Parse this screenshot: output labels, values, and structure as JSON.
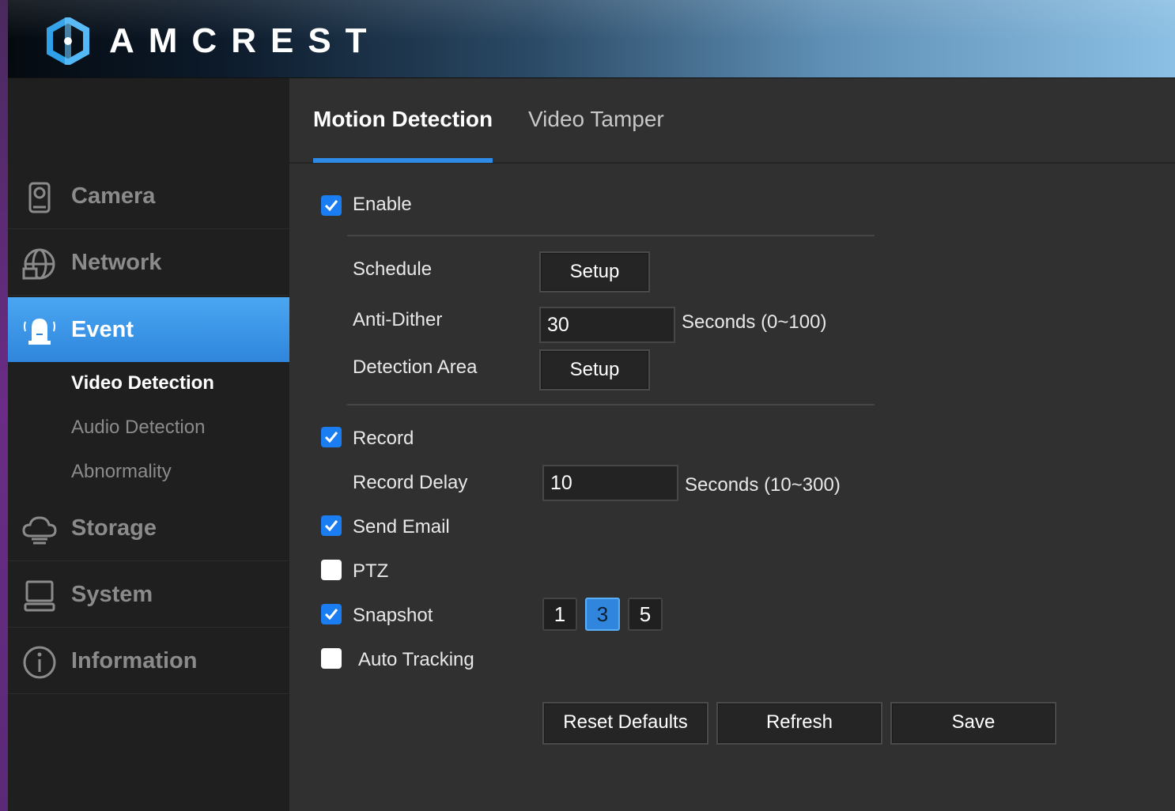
{
  "brand": {
    "name": "AMCREST"
  },
  "sidebar": {
    "items": [
      {
        "label": "Camera",
        "icon": "camera-icon"
      },
      {
        "label": "Network",
        "icon": "globe-network-icon"
      },
      {
        "label": "Event",
        "icon": "alarm-bell-icon",
        "active": true
      },
      {
        "label": "Storage",
        "icon": "cloud-storage-icon"
      },
      {
        "label": "System",
        "icon": "computer-icon"
      },
      {
        "label": "Information",
        "icon": "info-icon"
      }
    ],
    "sub_items": [
      {
        "label": "Video Detection",
        "active": true
      },
      {
        "label": "Audio Detection"
      },
      {
        "label": "Abnormality"
      }
    ]
  },
  "tabs": [
    {
      "label": "Motion Detection",
      "active": true
    },
    {
      "label": "Video Tamper"
    }
  ],
  "form": {
    "enable": {
      "label": "Enable",
      "checked": true
    },
    "schedule": {
      "label": "Schedule",
      "button": "Setup"
    },
    "anti_dither": {
      "label": "Anti-Dither",
      "value": "30",
      "unit": "Seconds (0~100)"
    },
    "detection_area": {
      "label": "Detection Area",
      "button": "Setup"
    },
    "record": {
      "label": "Record",
      "checked": true
    },
    "record_delay": {
      "label": "Record Delay",
      "value": "10",
      "unit": "Seconds (10~300)"
    },
    "send_email": {
      "label": "Send Email",
      "checked": true
    },
    "ptz": {
      "label": "PTZ",
      "checked": false
    },
    "snapshot": {
      "label": "Snapshot",
      "checked": true,
      "options": [
        "1",
        "3",
        "5"
      ],
      "selected": "3"
    },
    "auto_tracking": {
      "label": "Auto Tracking",
      "checked": false
    }
  },
  "actions": {
    "reset_defaults": "Reset Defaults",
    "refresh": "Refresh",
    "save": "Save"
  },
  "colors": {
    "accent": "#2f86dc",
    "checkbox_on": "#1a7ef2",
    "sidebar_bg": "#1f1f1f",
    "content_bg": "#303030"
  }
}
